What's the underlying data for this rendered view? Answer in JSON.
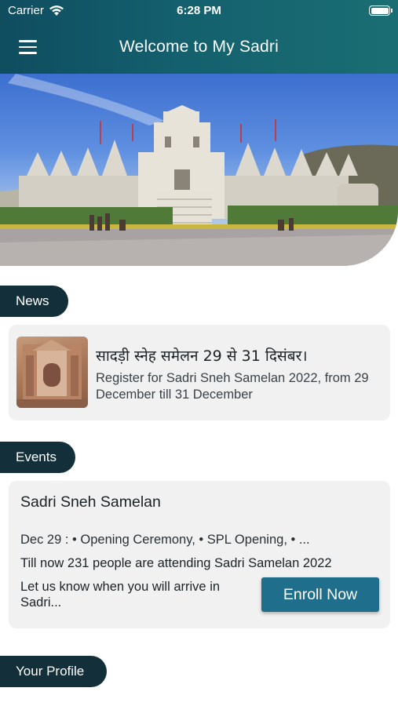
{
  "status_bar": {
    "carrier": "Carrier",
    "time": "6:28 PM"
  },
  "header": {
    "title": "Welcome to My Sadri",
    "menu_icon": "hamburger-menu-icon"
  },
  "sections": {
    "news": "News",
    "events": "Events",
    "profile": "Your Profile"
  },
  "news": [
    {
      "title": "सादड़ी स्नेह समेलन 29 से 31 दिसंबर।",
      "body": "Register for Sadri Sneh Samelan 2022, from 29 December till 31 December"
    }
  ],
  "event": {
    "name": "Sadri Sneh Samelan",
    "schedule": "Dec 29 : • Opening Ceremony, • SPL Opening, • ...",
    "attending": "Till now 231 people are attending Sadri Samelan 2022",
    "arrival_prompt": "Let us know when you will arrive in Sadri...",
    "enroll_label": "Enroll Now"
  },
  "colors": {
    "header": "#14606e",
    "section_tag": "#13303a",
    "button": "#1f6e8c",
    "card": "#f1f1f1"
  }
}
